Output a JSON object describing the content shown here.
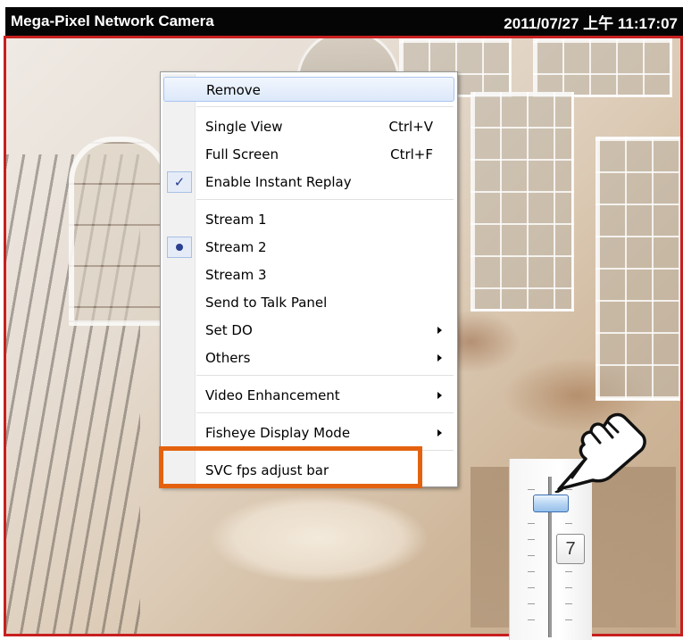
{
  "camera": {
    "name": "Mega-Pixel Network Camera",
    "timestamp": "2011/07/27 上午 11:17:07"
  },
  "context_menu": {
    "items": [
      {
        "label": "Remove",
        "highlighted": true
      },
      {
        "label": "Single View",
        "shortcut": "Ctrl+V"
      },
      {
        "label": "Full Screen",
        "shortcut": "Ctrl+F"
      },
      {
        "label": "Enable Instant Replay",
        "checked": true
      },
      {
        "label": "Stream 1"
      },
      {
        "label": "Stream 2",
        "selected": true
      },
      {
        "label": "Stream 3"
      },
      {
        "label": "Send to Talk Panel"
      },
      {
        "label": "Set DO",
        "submenu": true
      },
      {
        "label": "Others",
        "submenu": true
      },
      {
        "label": "Video Enhancement",
        "submenu": true
      },
      {
        "label": "Fisheye Display Mode",
        "submenu": true
      },
      {
        "label": "SVC fps adjust bar",
        "callout": true
      }
    ]
  },
  "fps_slider": {
    "value": "7"
  },
  "colors": {
    "callout_border": "#e4620f",
    "view_border": "#c81f1f",
    "menu_highlight": "#dce8fa"
  }
}
